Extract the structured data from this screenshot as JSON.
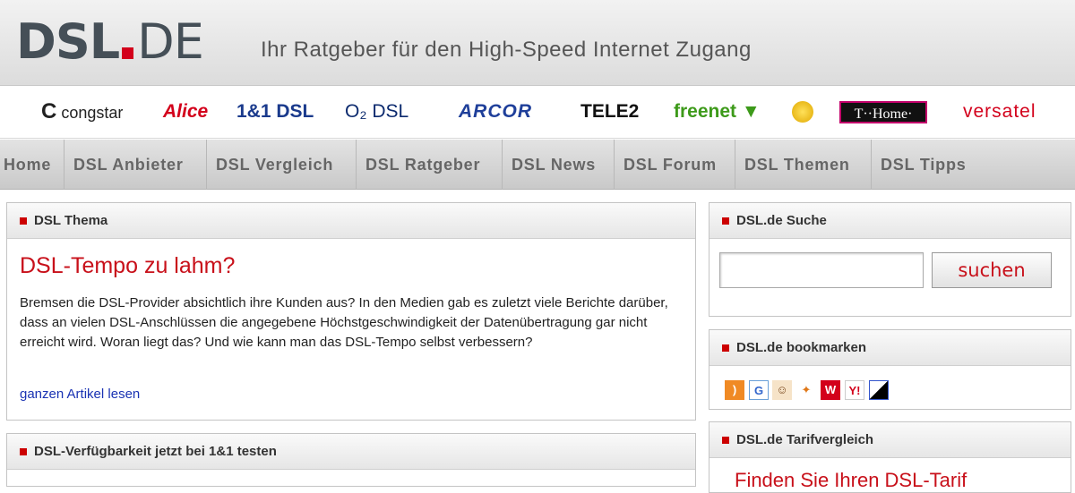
{
  "header": {
    "logo_part1": "DSL",
    "logo_part2": "DE",
    "tagline": "Ihr Ratgeber für den High-Speed Internet Zugang"
  },
  "brands": [
    {
      "name": "congstar",
      "color": "#222222"
    },
    {
      "name": "Alice",
      "color": "#d3001b"
    },
    {
      "name": "1&1 DSL",
      "color": "#1a3a8c"
    },
    {
      "name": "O₂ DSL",
      "color": "#0c2a6e"
    },
    {
      "name": "ARCOR",
      "color": "#1f3f9a"
    },
    {
      "name": "TELE2",
      "color": "#111111"
    },
    {
      "name": "freenet",
      "color": "#3d9a1a"
    },
    {
      "name": "T··Home·",
      "color": "#ffffff"
    },
    {
      "name": "versatel",
      "color": "#d3001b"
    }
  ],
  "nav": [
    "Home",
    "DSL Anbieter",
    "DSL Vergleich",
    "DSL Ratgeber",
    "DSL News",
    "DSL Forum",
    "DSL Themen",
    "DSL Tipps"
  ],
  "thema": {
    "heading": "DSL Thema",
    "title": "DSL-Tempo zu lahm?",
    "text": "Bremsen die DSL-Provider absichtlich ihre Kunden aus? In den Medien gab es zuletzt viele Berichte darüber, dass an vielen DSL-Anschlüssen die angegebene Höchstgeschwindigkeit der Datenübertragung gar nicht erreicht wird. Woran liegt das? Und wie kann man das DSL-Tempo selbst verbessern?",
    "link": "ganzen Artikel lesen"
  },
  "verfuegbarkeit": {
    "heading": "DSL-Verfügbarkeit jetzt bei 1&1 testen"
  },
  "suche": {
    "heading": "DSL.de Suche",
    "button": "suchen",
    "value": ""
  },
  "bookmarks": {
    "heading": "DSL.de bookmarken"
  },
  "tarif": {
    "heading": "DSL.de Tarifvergleich",
    "teaser": "Finden Sie Ihren DSL-Tarif"
  }
}
